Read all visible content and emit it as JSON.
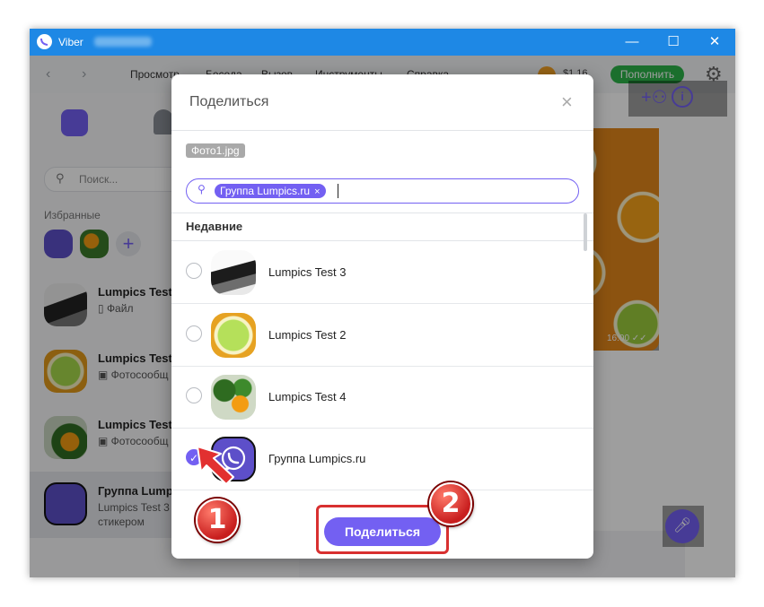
{
  "window": {
    "title": "Viber",
    "controls": {
      "minimize": "—",
      "maximize": "☐",
      "close": "✕"
    }
  },
  "menubar": {
    "items": [
      "Просмотр",
      "Беседа",
      "Вызов",
      "Инструменты",
      "Справка"
    ],
    "balance": "$1.16",
    "topup_label": "Пополнить"
  },
  "sidebar": {
    "search_placeholder": "Поиск...",
    "favorites_label": "Избранные",
    "chats": [
      {
        "name": "Lumpics Test",
        "subtitle": "Файл",
        "sub_icon": "file-icon"
      },
      {
        "name": "Lumpics Test",
        "subtitle": "Фотосообщ",
        "sub_icon": "photo-icon"
      },
      {
        "name": "Lumpics Test",
        "subtitle": "Фотосообщ",
        "sub_icon": "photo-icon"
      },
      {
        "name": "Группа Lump",
        "subtitle": "Lumpics Test 3",
        "subtitle2": "стикером"
      }
    ]
  },
  "conversation": {
    "photo_time": "16:00 ✓✓"
  },
  "modal": {
    "title": "Поделиться",
    "close_icon": "×",
    "file_name": "Фото1.jpg",
    "recipient_chip": "Группа Lumpics.ru",
    "recipient_chip_remove": "×",
    "recent_label": "Недавние",
    "contacts": [
      {
        "name": "Lumpics Test 3",
        "checked": false,
        "avatar": "laptop-photo"
      },
      {
        "name": "Lumpics Test 2",
        "checked": false,
        "avatar": "lime-photo"
      },
      {
        "name": "Lumpics Test 4",
        "checked": false,
        "avatar": "orange-tree-photo"
      },
      {
        "name": "Группа Lumpics.ru",
        "checked": true,
        "avatar": "viber-group-icon"
      }
    ],
    "share_button": "Поделиться"
  },
  "annotations": {
    "step1": "1",
    "step2": "2",
    "highlight_color": "#d83030"
  },
  "colors": {
    "viber_purple": "#7360f2",
    "titlebar_blue": "#1e88e5",
    "topup_green": "#2db34a"
  }
}
